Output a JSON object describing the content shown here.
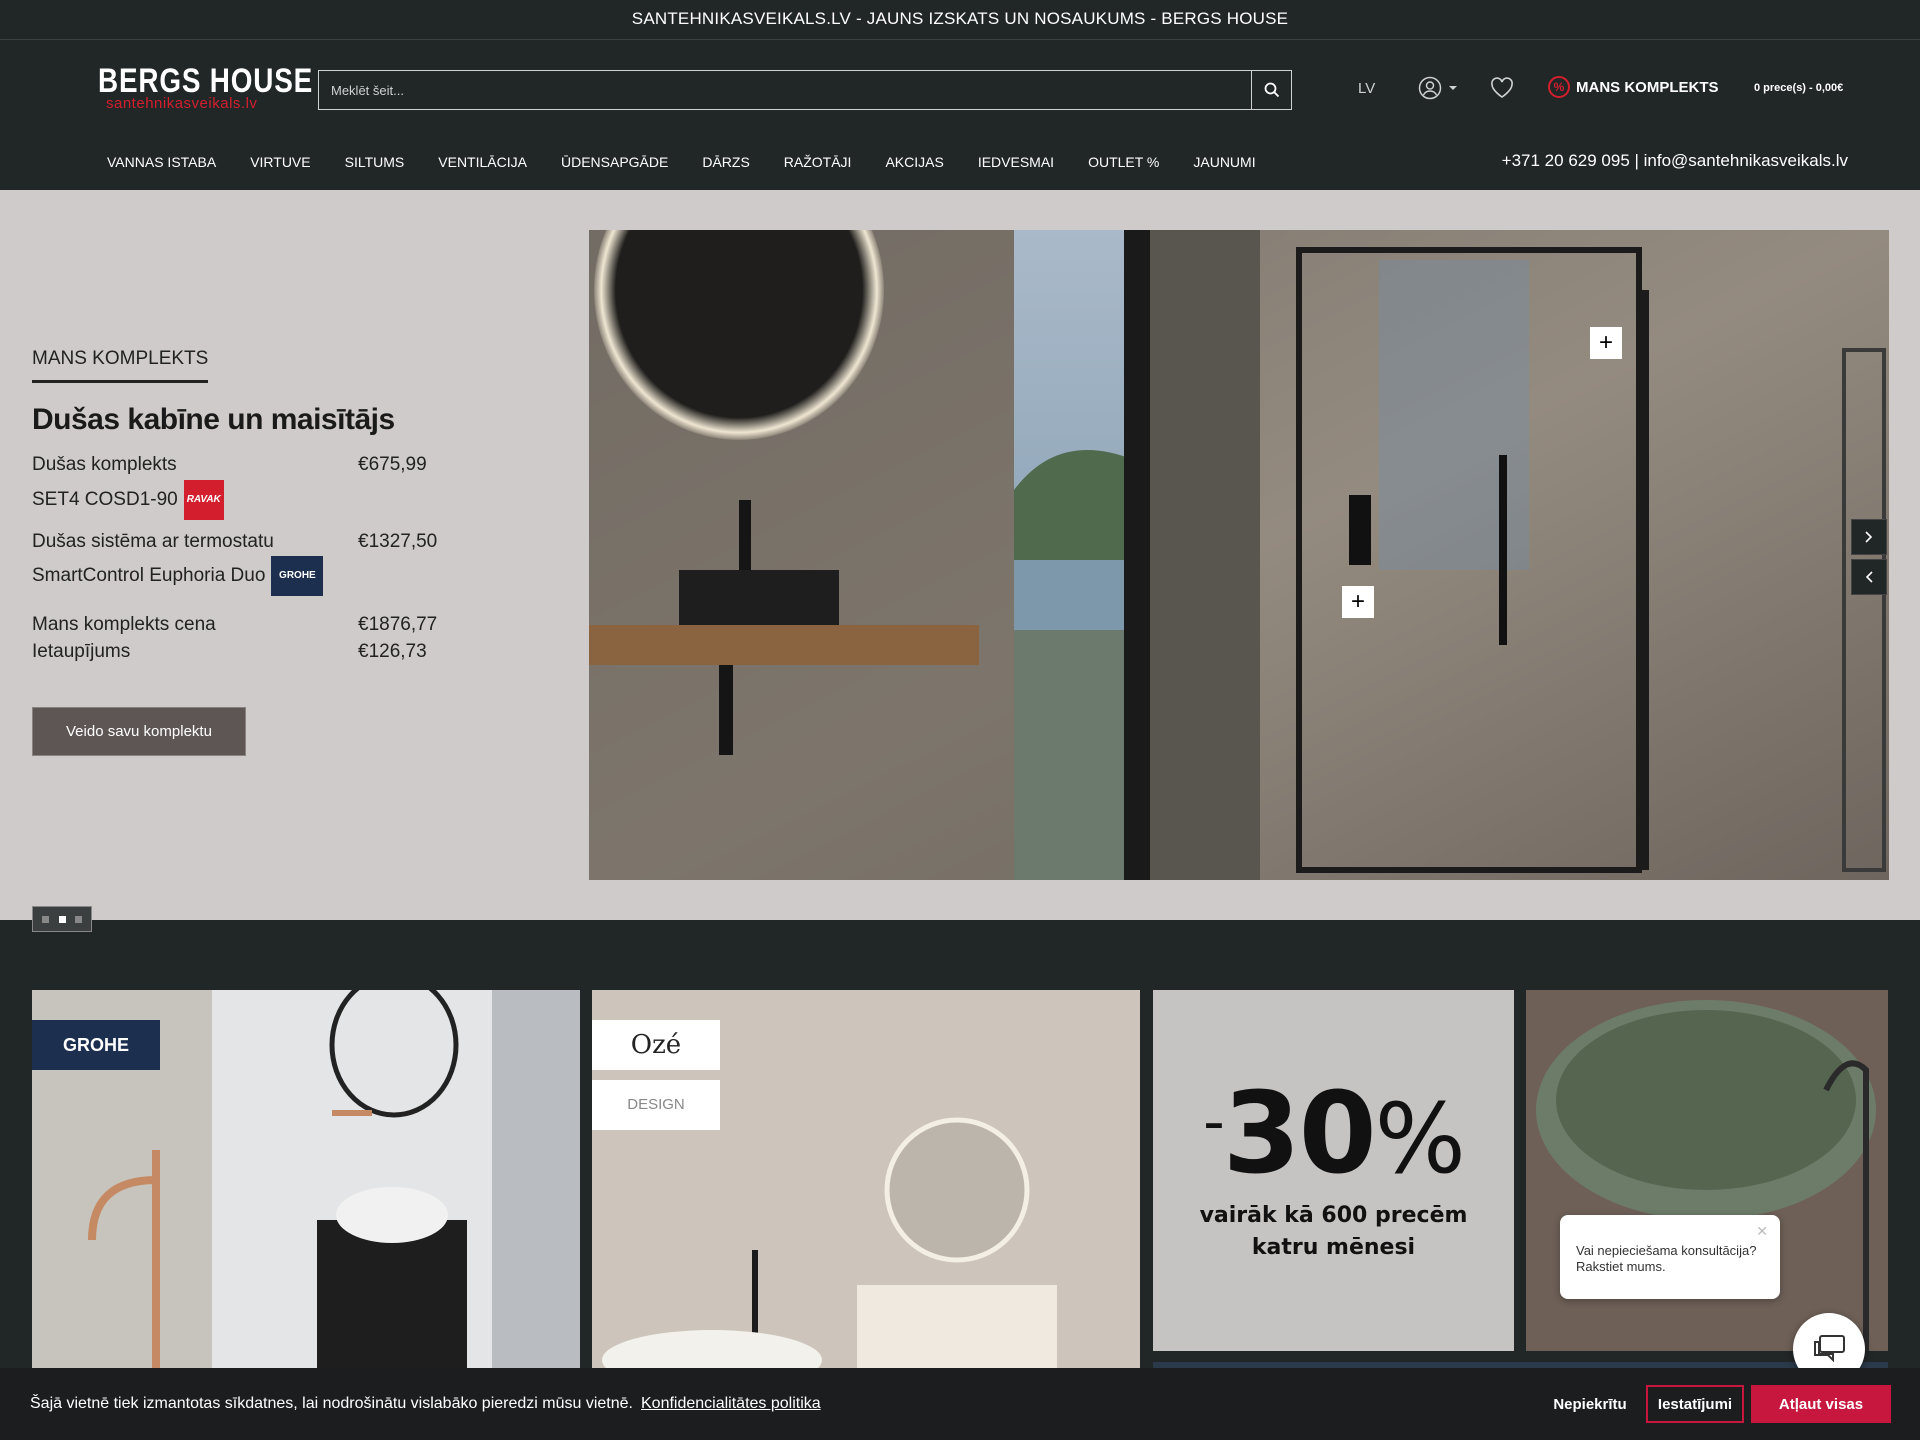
{
  "topbar": {
    "text": "SANTEHNIKASVEIKALS.LV - JAUNS IZSKATS UN NOSAUKUMS - BERGS HOUSE"
  },
  "header": {
    "logo_main": "BERGS HOUSE",
    "logo_sub": "santehnikasveikals.lv",
    "search_placeholder": "Meklēt šeit...",
    "lang": "LV",
    "komplekts_label": "MANS KOMPLEKTS",
    "cart": "0 prece(s) - 0,00€"
  },
  "nav": {
    "items": [
      "VANNAS ISTABA",
      "VIRTUVE",
      "SILTUMS",
      "VENTILĀCIJA",
      "ŪDENSAPGĀDE",
      "DĀRZS",
      "RAŽOTĀJI",
      "AKCIJAS",
      "IEDVESMAI",
      "OUTLET %",
      "JAUNUMI"
    ],
    "contact": "+371 20 629 095 | info@santehnikasveikals.lv"
  },
  "hero": {
    "section_label": "MANS KOMPLEKTS",
    "title": "Dušas kabīne un maisītājs",
    "products": [
      {
        "name_l1": "Dušas komplekts",
        "name_l2": "SET4 COSD1-90",
        "price": "€675,99",
        "brand": "RAVAK"
      },
      {
        "name_l1": "Dušas sistēma ar termostatu",
        "name_l2": "SmartControl Euphoria Duo",
        "price": "€1327,50",
        "brand": "GROHE"
      }
    ],
    "total_label": "Mans komplekts cena",
    "total_value": "€1876,77",
    "savings_label": "Ietaupījums",
    "savings_value": "€126,73",
    "cta": "Veido savu komplektu"
  },
  "tiles": {
    "grohe_logo": "GROHE",
    "oze_logo": "Ozé",
    "design_logo": "DESIGN",
    "promo_minus": "-",
    "promo_number": "30",
    "promo_pct": "%",
    "promo_line1": "vairāk kā 600 precēm",
    "promo_line2": "katru mēnesi"
  },
  "chat": {
    "message": "Vai nepieciešama konsultācija? Rakstiet mums."
  },
  "cookie": {
    "text": "Šajā vietnē tiek izmantotas sīkdatnes, lai nodrošinātu vislabāko pieredzi mūsu vietnē.",
    "link": "Konfidencialitātes politika",
    "deny": "Nepiekrītu",
    "settings": "Iestatījumi",
    "allow": "Atļaut visas"
  },
  "colors": {
    "accent_red": "#d31f2d",
    "dark_bg": "#212627",
    "hero_bg": "#cfcbca",
    "allow_btn": "#c8173f"
  }
}
